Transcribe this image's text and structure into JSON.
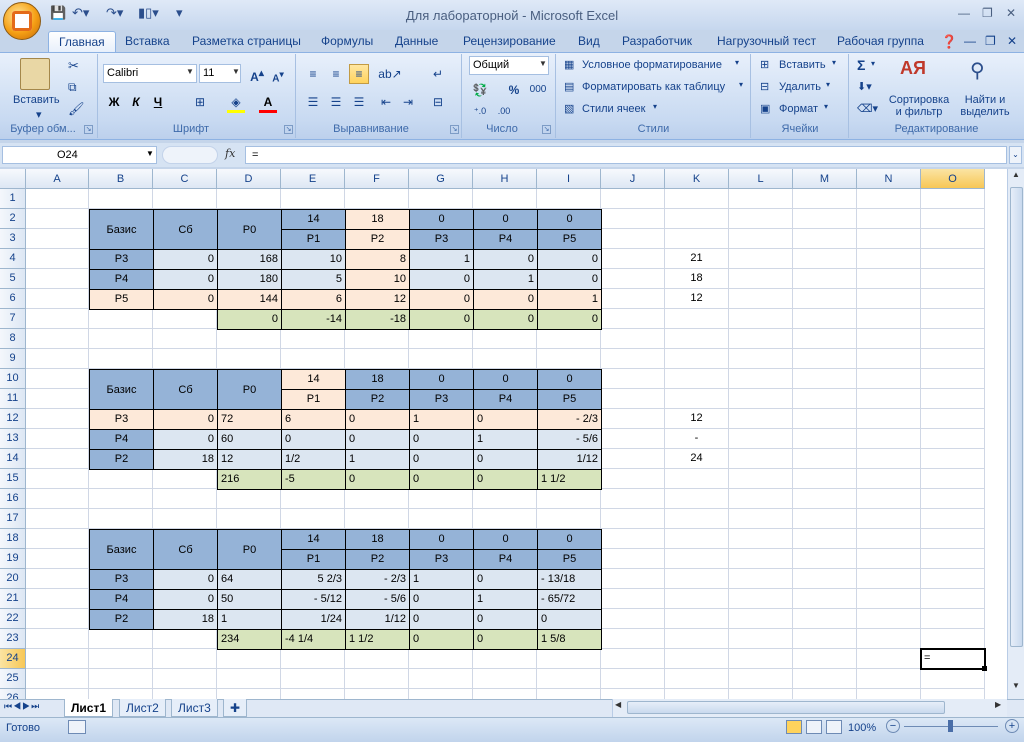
{
  "window": {
    "title": "Для лабораторной - Microsoft Excel"
  },
  "tabs": [
    "Главная",
    "Вставка",
    "Разметка страницы",
    "Формулы",
    "Данные",
    "Рецензирование",
    "Вид",
    "Разработчик",
    "Нагрузочный тест",
    "Рабочая группа"
  ],
  "ribbon": {
    "clipboard": {
      "paste": "Вставить",
      "label": "Буфер обм..."
    },
    "font": {
      "name": "Calibri",
      "size": "11",
      "bold": "Ж",
      "italic": "К",
      "underline": "Ч",
      "label": "Шрифт"
    },
    "alignment": {
      "label": "Выравнивание"
    },
    "number": {
      "format": "Общий",
      "percent": "%",
      "thousands": "000",
      "label": "Число"
    },
    "styles": {
      "conditional": "Условное форматирование",
      "table": "Форматировать как таблицу",
      "cell_styles": "Стили ячеек",
      "label": "Стили"
    },
    "cells": {
      "insert": "Вставить",
      "delete": "Удалить",
      "format": "Формат",
      "label": "Ячейки"
    },
    "editing": {
      "sum": "Σ",
      "sort": "Сортировка и фильтр",
      "find": "Найти и выделить",
      "label": "Редактирование"
    }
  },
  "formula_bar": {
    "name_box": "O24",
    "fx": "fx",
    "formula": "="
  },
  "columns": [
    "A",
    "B",
    "C",
    "D",
    "E",
    "F",
    "G",
    "H",
    "I",
    "J",
    "K",
    "L",
    "M",
    "N",
    "O"
  ],
  "rows": [
    "1",
    "2",
    "3",
    "4",
    "5",
    "6",
    "7",
    "8",
    "9",
    "10",
    "11",
    "12",
    "13",
    "14",
    "15",
    "16",
    "17",
    "18",
    "19",
    "20",
    "21",
    "22",
    "23",
    "24",
    "25",
    "26"
  ],
  "table1": {
    "header": [
      "Базис",
      "Сб",
      "P0"
    ],
    "costs": [
      "14",
      "18",
      "0",
      "0",
      "0"
    ],
    "vars": [
      "P1",
      "P2",
      "P3",
      "P4",
      "P5"
    ],
    "rows": [
      [
        "P3",
        "0",
        "168",
        "10",
        "8",
        "1",
        "0",
        "0"
      ],
      [
        "P4",
        "0",
        "180",
        "5",
        "10",
        "0",
        "1",
        "0"
      ],
      [
        "P5",
        "0",
        "144",
        "6",
        "12",
        "0",
        "0",
        "1"
      ]
    ],
    "delta": [
      "0",
      "-14",
      "-18",
      "0",
      "0",
      "0"
    ],
    "ratios": [
      "21",
      "18",
      "12"
    ]
  },
  "table2": {
    "header": [
      "Базис",
      "Сб",
      "P0"
    ],
    "costs": [
      "14",
      "18",
      "0",
      "0",
      "0"
    ],
    "vars": [
      "P1",
      "P2",
      "P3",
      "P4",
      "P5"
    ],
    "rows": [
      [
        "P3",
        "0",
        "72",
        "6",
        "0",
        "1",
        "0",
        "-   2/3"
      ],
      [
        "P4",
        "0",
        "60",
        "0",
        "0",
        "0",
        "1",
        "-   5/6"
      ],
      [
        "P2",
        "18",
        "12",
        "1/2",
        "1",
        "0",
        "0",
        "1/12"
      ]
    ],
    "delta": [
      "216",
      "-5",
      "0",
      "0",
      "0",
      "1   1/2"
    ],
    "ratios": [
      "12",
      "-",
      "24"
    ]
  },
  "table3": {
    "header": [
      "Базис",
      "Сб",
      "P0"
    ],
    "costs": [
      "14",
      "18",
      "0",
      "0",
      "0"
    ],
    "vars": [
      "P1",
      "P2",
      "P3",
      "P4",
      "P5"
    ],
    "rows": [
      [
        "P3",
        "0",
        "64",
        "5   2/3",
        "-   2/3",
        "1",
        "0",
        "- 13/18"
      ],
      [
        "P4",
        "0",
        "50",
        "-   5/12",
        "-   5/6",
        "0",
        "1",
        "- 65/72"
      ],
      [
        "P2",
        "18",
        "1",
        "1/24",
        "1/12",
        "0",
        "0",
        "0"
      ]
    ],
    "delta": [
      "234",
      "-4   1/4",
      "1   1/2",
      "0",
      "0",
      "1   5/8"
    ]
  },
  "active_cell_value": "=",
  "sheets": [
    "Лист1",
    "Лист2",
    "Лист3"
  ],
  "status": {
    "ready": "Готово",
    "zoom": "100%"
  }
}
